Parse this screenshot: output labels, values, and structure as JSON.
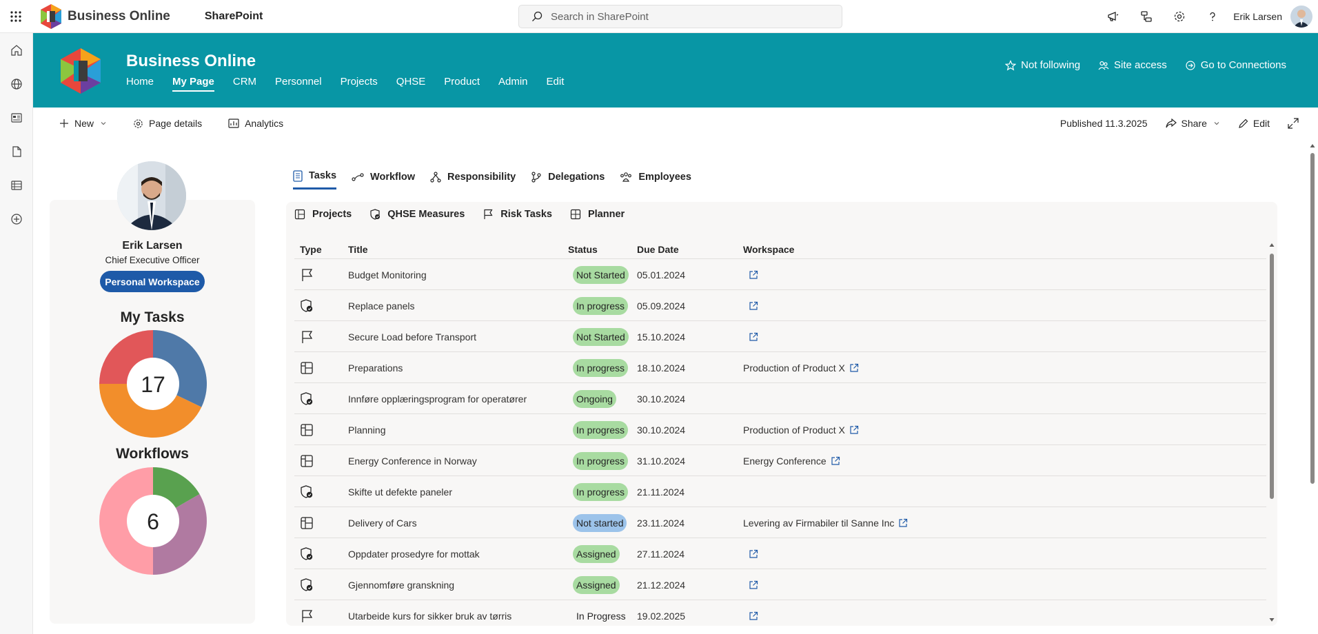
{
  "suite": {
    "brand": "Business Online",
    "app": "SharePoint",
    "search_placeholder": "Search in SharePoint",
    "user_name": "Erik Larsen"
  },
  "site": {
    "title": "Business Online",
    "nav": [
      "Home",
      "My Page",
      "CRM",
      "Personnel",
      "Projects",
      "QHSE",
      "Product",
      "Admin",
      "Edit"
    ],
    "active_nav": "My Page",
    "actions": {
      "follow": "Not following",
      "access": "Site access",
      "connections": "Go to Connections"
    },
    "color": "#0896a5"
  },
  "commandbar": {
    "new": "New",
    "page_details": "Page details",
    "analytics": "Analytics",
    "published": "Published 11.3.2025",
    "share": "Share",
    "edit": "Edit"
  },
  "profile": {
    "name": "Erik Larsen",
    "role": "Chief Executive Officer",
    "workspace_button": "Personal Workspace",
    "my_tasks_title": "My Tasks",
    "my_tasks_count": "17",
    "workflows_title": "Workflows",
    "workflows_count": "6"
  },
  "tabs": [
    "Tasks",
    "Workflow",
    "Responsibility",
    "Delegations",
    "Employees"
  ],
  "subtabs": [
    "Projects",
    "QHSE Measures",
    "Risk Tasks",
    "Planner"
  ],
  "table": {
    "headers": {
      "type": "Type",
      "title": "Title",
      "status": "Status",
      "due": "Due Date",
      "workspace": "Workspace"
    },
    "rows": [
      {
        "type": "flag-icon",
        "title": "Budget Monitoring",
        "status": "Not Started",
        "status_style": "green",
        "due": "05.01.2024",
        "workspace": "",
        "ext": true
      },
      {
        "type": "shield-check-icon",
        "title": "Replace panels",
        "status": "In progress",
        "status_style": "green",
        "due": "05.09.2024",
        "workspace": "",
        "ext": true
      },
      {
        "type": "flag-icon",
        "title": "Secure Load before Transport",
        "status": "Not Started",
        "status_style": "green",
        "due": "15.10.2024",
        "workspace": "",
        "ext": true
      },
      {
        "type": "planner-icon",
        "title": "Preparations",
        "status": "In progress",
        "status_style": "green",
        "due": "18.10.2024",
        "workspace": "Production of Product X",
        "ext": true
      },
      {
        "type": "shield-check-icon",
        "title": "Innføre opplæringsprogram for operatører",
        "status": "Ongoing",
        "status_style": "green",
        "due": "30.10.2024",
        "workspace": "",
        "ext": false
      },
      {
        "type": "planner-icon",
        "title": "Planning",
        "status": "In progress",
        "status_style": "green",
        "due": "30.10.2024",
        "workspace": "Production of Product X",
        "ext": true
      },
      {
        "type": "planner-icon",
        "title": "Energy Conference in Norway",
        "status": "In progress",
        "status_style": "green",
        "due": "31.10.2024",
        "workspace": "Energy Conference",
        "ext": true
      },
      {
        "type": "shield-check-icon",
        "title": "Skifte ut defekte paneler",
        "status": "In progress",
        "status_style": "green",
        "due": "21.11.2024",
        "workspace": "",
        "ext": false
      },
      {
        "type": "planner-icon",
        "title": "Delivery of Cars",
        "status": "Not started",
        "status_style": "blue",
        "due": "23.11.2024",
        "workspace": "Levering av Firmabiler til Sanne Inc",
        "ext": true
      },
      {
        "type": "shield-check-icon",
        "title": "Oppdater prosedyre for mottak",
        "status": "Assigned",
        "status_style": "green",
        "due": "27.11.2024",
        "workspace": "",
        "ext": true
      },
      {
        "type": "shield-check-icon",
        "title": "Gjennomføre granskning",
        "status": "Assigned",
        "status_style": "green",
        "due": "21.12.2024",
        "workspace": "",
        "ext": true
      },
      {
        "type": "flag-icon",
        "title": "Utarbeide kurs for sikker bruk av tørris",
        "status": "In Progress",
        "status_style": "none",
        "due": "19.02.2025",
        "workspace": "",
        "ext": true
      }
    ]
  }
}
